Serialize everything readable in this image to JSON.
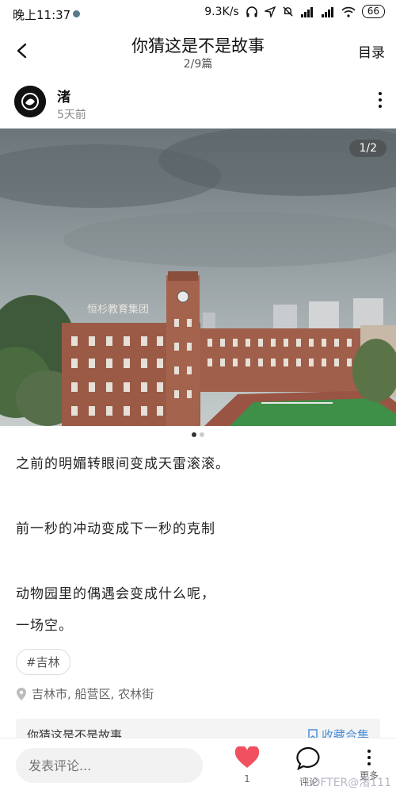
{
  "status_bar": {
    "time": "晚上11:37",
    "net_speed": "9.3K/s",
    "battery": "66"
  },
  "header": {
    "title": "你猜这是不是故事",
    "subtitle": "2/9篇",
    "toc_label": "目录"
  },
  "author": {
    "name": "渚",
    "time": "5天前"
  },
  "photo": {
    "indicator": "1/2",
    "sign_text": "恒杉教育集团"
  },
  "content": {
    "paragraphs": [
      "之前的明媚转眼间变成天雷滚滚。",
      "前一秒的冲动变成下一秒的克制",
      "动物园里的偶遇会变成什么呢，",
      "一场空。"
    ],
    "tag": "#吉林",
    "location": "吉林市, 船营区, 农林街"
  },
  "collection": {
    "title": "你猜这是不是故事",
    "button": "收藏合集"
  },
  "bottom_bar": {
    "comment_placeholder": "发表评论...",
    "like_count": "1",
    "comment_label": "评论",
    "more_label": "更多"
  },
  "watermark": "LOFTER@渚111",
  "colors": {
    "like_red": "#f0505f",
    "collection_blue": "#4a8fd6"
  }
}
